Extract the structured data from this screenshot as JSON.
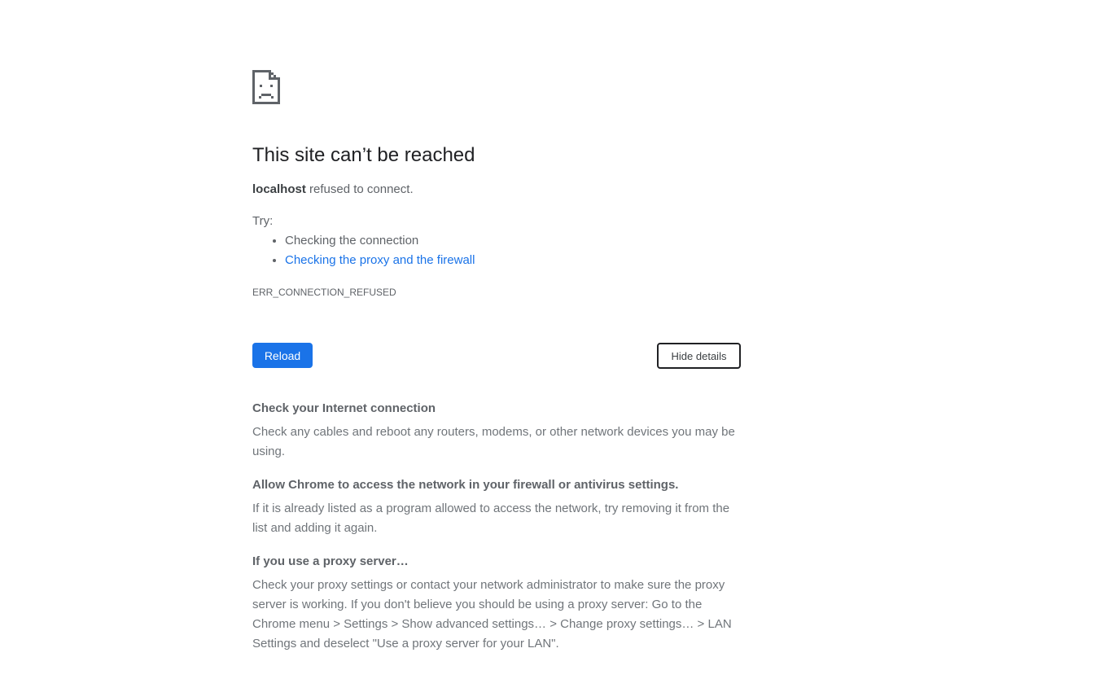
{
  "error": {
    "title": "This site can’t be reached",
    "host": "localhost",
    "message": " refused to connect.",
    "try_label": "Try:",
    "suggestions": [
      "Checking the connection",
      "Checking the proxy and the firewall"
    ],
    "code": "ERR_CONNECTION_REFUSED"
  },
  "buttons": {
    "reload": "Reload",
    "hide_details": "Hide details"
  },
  "details": [
    {
      "heading": "Check your Internet connection",
      "body": "Check any cables and reboot any routers, modems, or other network devices you may be using."
    },
    {
      "heading": "Allow Chrome to access the network in your firewall or antivirus settings.",
      "body": "If it is already listed as a program allowed to access the network, try removing it from the list and adding it again."
    },
    {
      "heading": "If you use a proxy server…",
      "body": "Check your proxy settings or contact your network administrator to make sure the proxy server is working. If you don't believe you should be using a proxy server: Go to the Chrome menu > Settings > Show advanced settings… > Change proxy settings… > LAN Settings and deselect \"Use a proxy server for your LAN\"."
    }
  ],
  "colors": {
    "accent": "#1a73e8",
    "title": "#202124",
    "text": "#5f6368"
  },
  "icons": {
    "error_icon": "sad-page-icon"
  }
}
